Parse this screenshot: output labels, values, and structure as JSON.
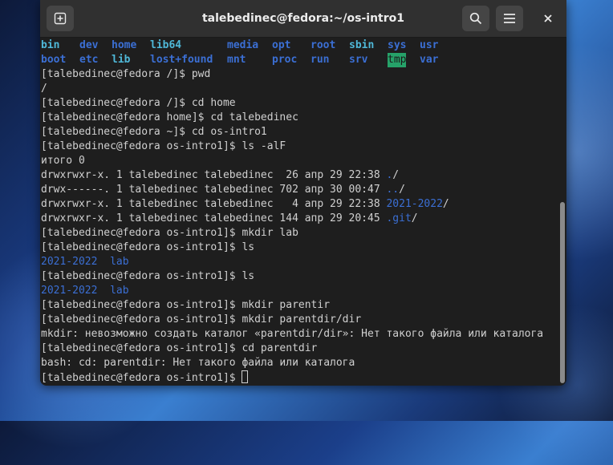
{
  "window": {
    "title": "talebedinec@fedora:~/os-intro1",
    "new_tab_icon": "plus-icon",
    "search_icon": "search-icon",
    "menu_icon": "hamburger-menu-icon",
    "close_icon": "close-icon"
  },
  "colors": {
    "directory": "#3b6fd4",
    "symlink": "#4fb8d8",
    "tmp_highlight": "#26a269",
    "terminal_bg": "#1e1e1e",
    "text": "#d0d0d0"
  },
  "terminal": {
    "ls_row1": [
      {
        "text": "bin",
        "type": "link"
      },
      {
        "text": "dev",
        "type": "dir"
      },
      {
        "text": "home",
        "type": "dir"
      },
      {
        "text": "lib64",
        "type": "link"
      },
      {
        "text": "media",
        "type": "dir"
      },
      {
        "text": "opt",
        "type": "dir"
      },
      {
        "text": "root",
        "type": "dir"
      },
      {
        "text": "sbin",
        "type": "link"
      },
      {
        "text": "sys",
        "type": "dir"
      },
      {
        "text": "usr",
        "type": "dir"
      }
    ],
    "ls_row2": [
      {
        "text": "boot",
        "type": "dir"
      },
      {
        "text": "etc",
        "type": "dir"
      },
      {
        "text": "lib",
        "type": "link"
      },
      {
        "text": "lost+found",
        "type": "dir"
      },
      {
        "text": "mnt",
        "type": "dir"
      },
      {
        "text": "proc",
        "type": "dir"
      },
      {
        "text": "run",
        "type": "dir"
      },
      {
        "text": "srv",
        "type": "dir"
      },
      {
        "text": "tmp",
        "type": "tmp"
      },
      {
        "text": "var",
        "type": "dir"
      }
    ],
    "lines": [
      {
        "prefix": "[talebedinec@fedora /]$ pwd"
      },
      {
        "prefix": "/"
      },
      {
        "prefix": "[talebedinec@fedora /]$ cd home"
      },
      {
        "prefix": "[talebedinec@fedora home]$ cd talebedinec"
      },
      {
        "prefix": "[talebedinec@fedora ~]$ cd os-intro1"
      },
      {
        "prefix": "[talebedinec@fedora os-intro1]$ ls -alF"
      },
      {
        "prefix": "итого 0"
      },
      {
        "prefix": "drwxrwxr-x. 1 talebedinec talebedinec  26 апр 29 22:38 ",
        "name": "./"
      },
      {
        "prefix": "drwx------. 1 talebedinec talebedinec 702 апр 30 00:47 ",
        "name": "../"
      },
      {
        "prefix": "drwxrwxr-x. 1 talebedinec talebedinec   4 апр 29 22:38 ",
        "name": "2021-2022/"
      },
      {
        "prefix": "drwxrwxr-x. 1 talebedinec talebedinec 144 апр 29 20:45 ",
        "name": ".git/"
      },
      {
        "prefix": "[talebedinec@fedora os-intro1]$ mkdir lab"
      },
      {
        "prefix": "[talebedinec@fedora os-intro1]$ ls"
      },
      {
        "prefix": "",
        "dirs": "2021-2022  lab"
      },
      {
        "prefix": "[talebedinec@fedora os-intro1]$ ls"
      },
      {
        "prefix": "",
        "dirs": "2021-2022  lab"
      },
      {
        "prefix": "[talebedinec@fedora os-intro1]$ mkdir parentir"
      },
      {
        "prefix": "[talebedinec@fedora os-intro1]$ mkdir parentdir/dir"
      },
      {
        "prefix": "mkdir: невозможно создать каталог «parentdir/dir»: Нет такого файла или каталога"
      },
      {
        "prefix": "[talebedinec@fedora os-intro1]$ cd parentdir"
      },
      {
        "prefix": "bash: cd: parentdir: Нет такого файла или каталога"
      },
      {
        "prefix": "[talebedinec@fedora os-intro1]$ ",
        "cursor": true
      }
    ]
  }
}
